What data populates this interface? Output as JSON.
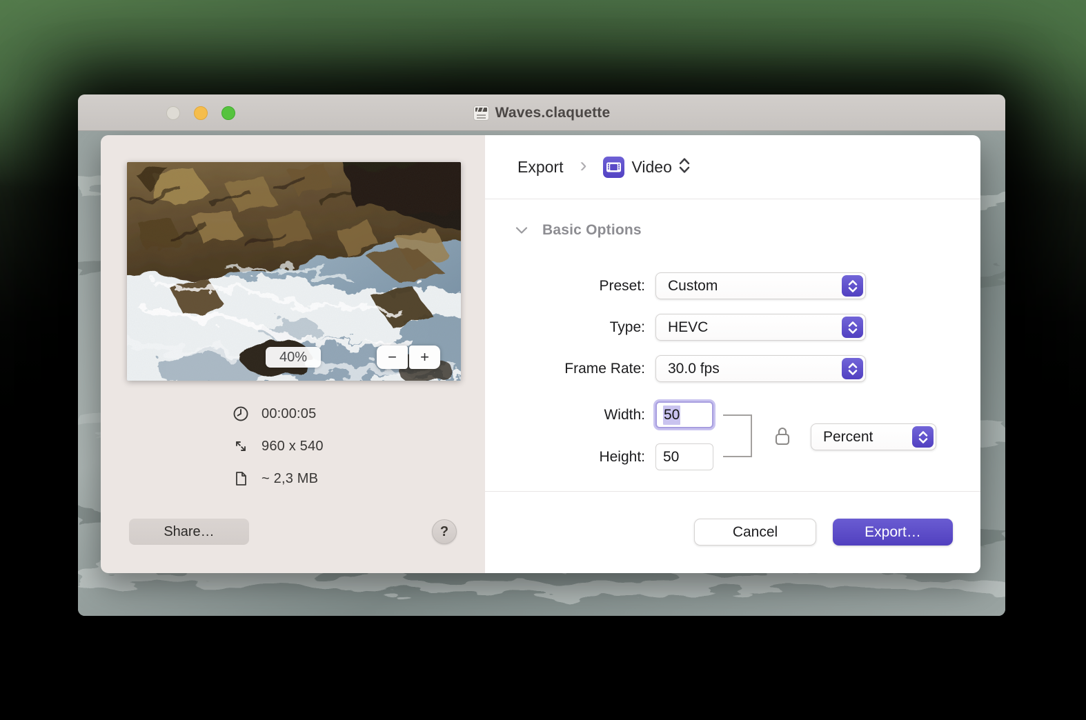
{
  "window": {
    "title": "Waves.claquette"
  },
  "preview": {
    "zoom_level": "40%",
    "zoom_out": "−",
    "zoom_in": "+",
    "duration": "00:00:05",
    "dimensions": "960 x 540",
    "file_size": "~ 2,3 MB",
    "share_label": "Share…",
    "help_label": "?"
  },
  "breadcrumb": {
    "root": "Export",
    "separator": "›",
    "current": "Video"
  },
  "section": {
    "title": "Basic Options"
  },
  "form": {
    "preset": {
      "label": "Preset:",
      "value": "Custom"
    },
    "type": {
      "label": "Type:",
      "value": "HEVC"
    },
    "frame_rate": {
      "label": "Frame Rate:",
      "value": "30.0 fps"
    },
    "width": {
      "label": "Width:",
      "value": "50"
    },
    "height": {
      "label": "Height:",
      "value": "50"
    },
    "unit": {
      "value": "Percent"
    }
  },
  "footer": {
    "cancel_label": "Cancel",
    "export_label": "Export…"
  },
  "colors": {
    "accent": "#5a49c8",
    "focus_ring": "#8578db",
    "selection": "#c9c3ef",
    "left_panel_bg": "#ece6e3",
    "titlebar_bg": "#cdc9c6",
    "traffic_yellow": "#f5bd4c",
    "traffic_green": "#56c33e"
  }
}
